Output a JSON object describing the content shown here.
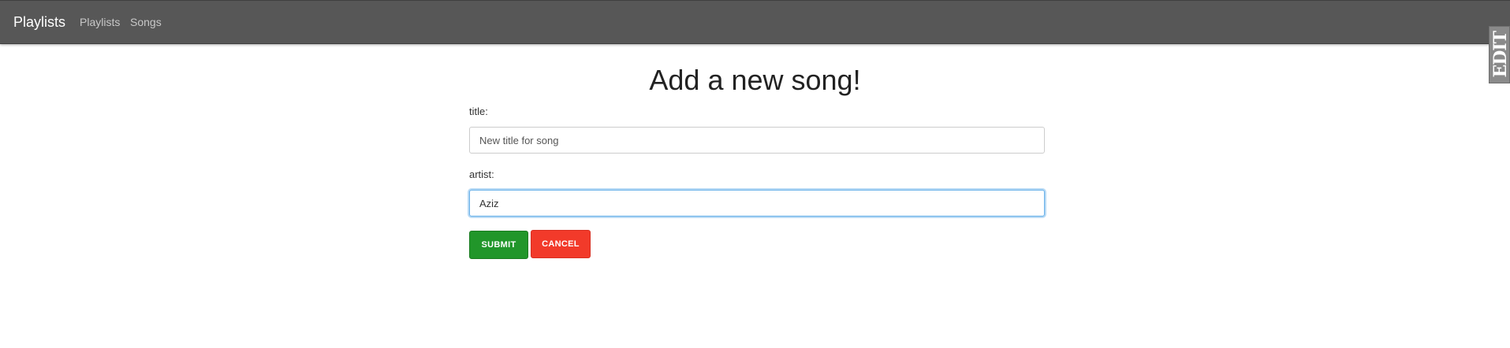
{
  "navbar": {
    "brand": "Playlists",
    "links": [
      {
        "label": "Playlists"
      },
      {
        "label": "Songs"
      }
    ]
  },
  "form": {
    "heading": "Add a new song!",
    "title_label": "title:",
    "title_placeholder": "New title for song",
    "title_value": "",
    "artist_label": "artist:",
    "artist_value": "Aziz",
    "submit_label": "SUBMIT",
    "cancel_label": "CANCEL"
  },
  "side_tab": {
    "text": "EDIT"
  },
  "colors": {
    "navbar_bg": "#575757",
    "submit_bg": "#21962a",
    "cancel_bg": "#f23a2a",
    "focus_border": "#66afe9"
  }
}
